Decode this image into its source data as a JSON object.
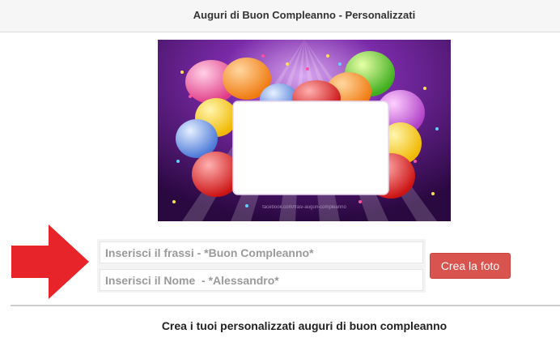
{
  "header": {
    "title": "Auguri di Buon Compleanno - Personalizzati"
  },
  "photo": {
    "description_icon": "balloons-frame-image",
    "watermark": "facebook.com/frasi-auguri-compleanno"
  },
  "form": {
    "phrase_placeholder": "Inserisci il frassi - *Buon Compleanno*",
    "name_placeholder": "Inserisci il Nome  - *Alessandro*",
    "submit_label": "Crea la foto"
  },
  "footer": {
    "text": "Crea i tuoi personalizzati auguri di buon compleanno"
  },
  "colors": {
    "accent": "#d9534f",
    "arrow": "#e8242b"
  }
}
